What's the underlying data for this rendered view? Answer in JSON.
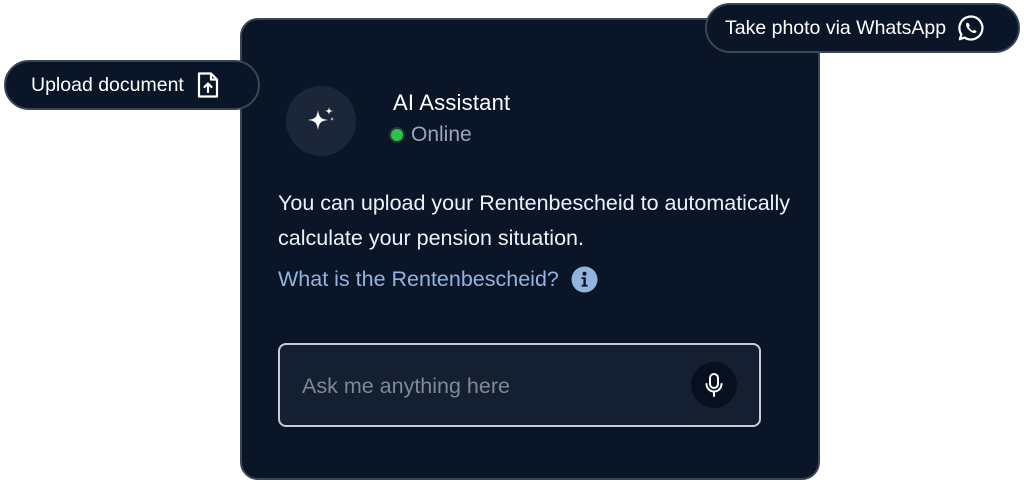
{
  "assistant": {
    "name": "AI Assistant",
    "status": "Online",
    "status_color": "#2fc24b",
    "avatar_icon": "sparkles-icon"
  },
  "message": {
    "text": "You can upload your Rentenbescheid to automatically calculate your pension situation."
  },
  "help_link": {
    "label": "What is the Rentenbescheid?",
    "icon": "info-icon"
  },
  "input": {
    "placeholder": "Ask me anything here",
    "value": "",
    "mic_icon": "microphone-icon"
  },
  "actions": {
    "upload_label": "Upload document",
    "upload_icon": "file-upload-icon",
    "whatsapp_label": "Take photo via WhatsApp",
    "whatsapp_icon": "whatsapp-icon"
  },
  "colors": {
    "card_background": "#0a1628",
    "link": "#93b4de",
    "border": "#3a4556"
  }
}
